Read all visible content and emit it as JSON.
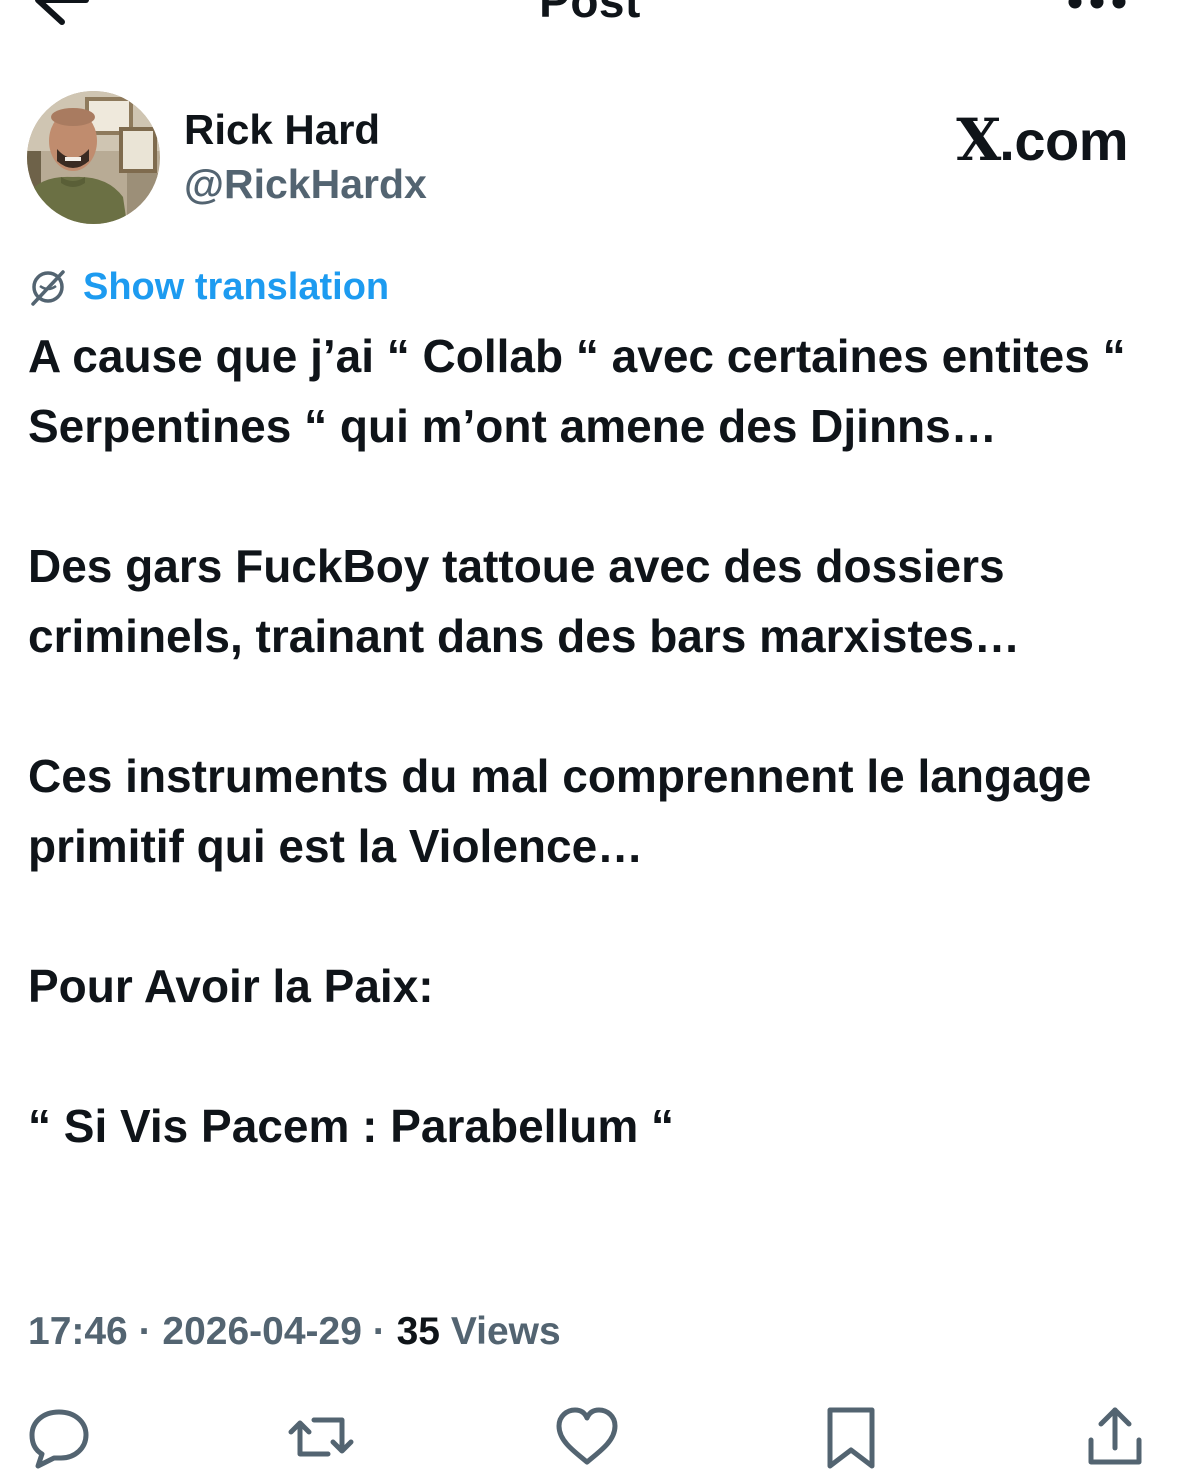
{
  "header": {
    "title": "Post",
    "back_icon": "arrow-left-icon",
    "more_icon": "more-horizontal-icon"
  },
  "author": {
    "display_name": "Rick Hard",
    "handle": "@RickHardx",
    "avatar_icon": "profile-photo"
  },
  "brand": {
    "glyph": "X",
    "suffix": ".com"
  },
  "translation": {
    "icon": "globe-icon",
    "label": "Show translation"
  },
  "tweet": {
    "paragraphs": [
      "A cause que j’ai “ Collab “ avec certaines entites “ Serpentines “  qui m’ont amene des Djinns…",
      "Des gars FuckBoy tattoue avec des dossiers criminels, trainant dans des bars marxistes…",
      "Ces instruments du mal comprennent le langage primitif qui est la Violence…",
      "Pour Avoir la Paix:",
      "“ Si Vis Pacem : Parabellum “"
    ]
  },
  "meta": {
    "time": "17:46",
    "separator": " · ",
    "date": "2026-04-29",
    "views_count": "35",
    "views_label": " Views"
  },
  "actions": {
    "reply_icon": "reply-icon",
    "repost_icon": "repost-icon",
    "like_icon": "heart-icon",
    "bookmark_icon": "bookmark-icon",
    "share_icon": "share-icon"
  },
  "colors": {
    "text": "#0f1419",
    "secondary": "#536471",
    "link": "#1d9bf0",
    "background": "#ffffff"
  }
}
